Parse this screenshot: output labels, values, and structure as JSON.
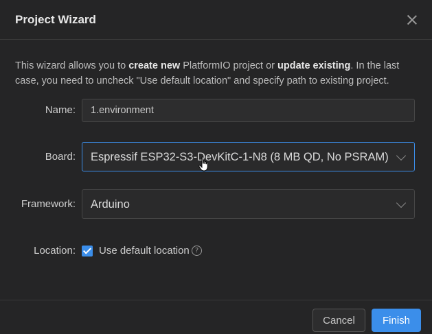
{
  "dialog": {
    "title": "Project Wizard",
    "close_icon": "close-icon"
  },
  "description": {
    "part1": "This wizard allows you to ",
    "bold1": "create new",
    "part2": " PlatformIO project or ",
    "bold2": "update existing",
    "part3": ". In the last case, you need to uncheck \"Use default location\" and specify path to existing project."
  },
  "form": {
    "name_label": "Name:",
    "name_value": "1.environment",
    "board_label": "Board:",
    "board_value": "Espressif ESP32-S3-DevKitC-1-N8 (8 MB QD, No PSRAM)",
    "framework_label": "Framework:",
    "framework_value": "Arduino",
    "location_label": "Location:",
    "use_default_location_label": "Use default location",
    "use_default_location_checked": true,
    "help_icon": "help-circle-icon"
  },
  "footer": {
    "cancel_label": "Cancel",
    "finish_label": "Finish"
  },
  "colors": {
    "accent": "#3b8eea",
    "background": "#252526"
  }
}
